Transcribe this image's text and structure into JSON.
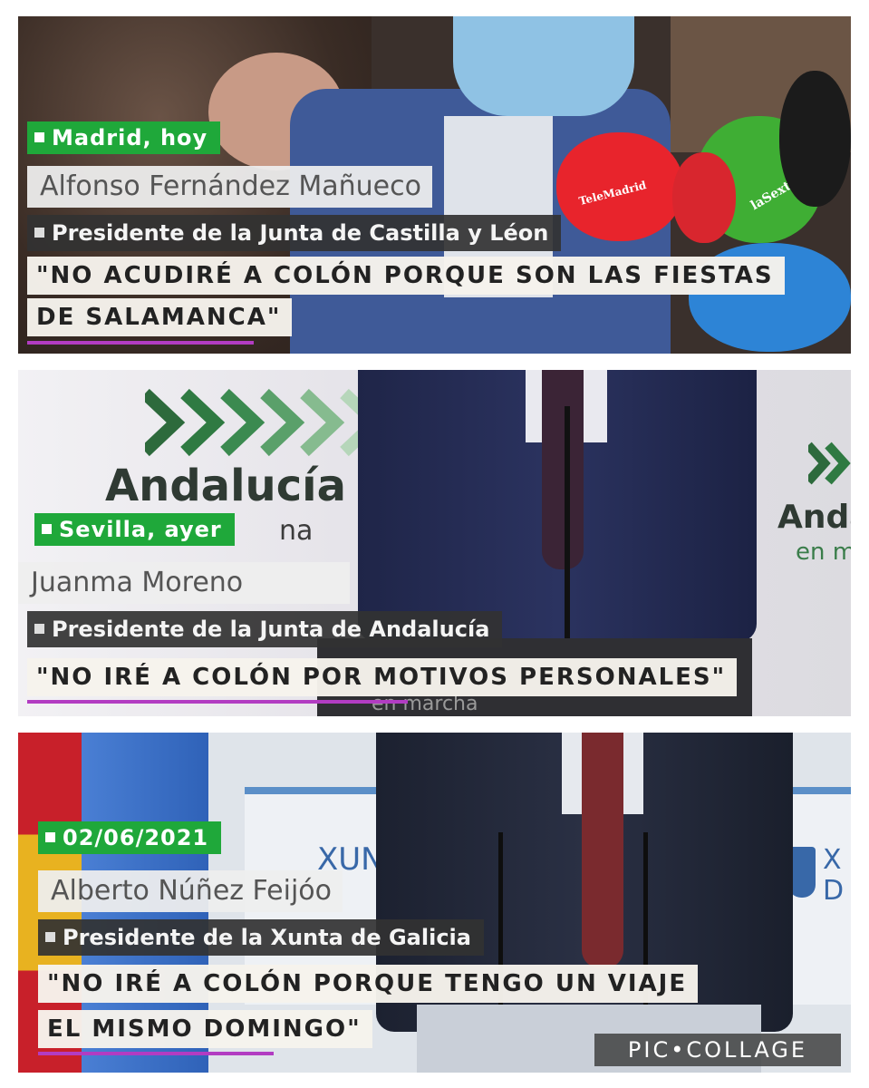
{
  "panels": [
    {
      "location": "Madrid, hoy",
      "name": "Alfonso Fernández Mañueco",
      "role": "Presidente de la Junta de Castilla y Léon",
      "quote_line1": "\"NO ACUDIRÉ A COLÓN PORQUE SON LAS FIESTAS",
      "quote_line2": "DE SALAMANCA\"",
      "mic_labels": [
        "TeleMadrid",
        "laSexta"
      ]
    },
    {
      "location": "Sevilla, ayer",
      "name": "Juanma Moreno",
      "role": "Presidente de la Junta de Andalucía",
      "quote_line1": "\"NO IRÉ A COLÓN POR MOTIVOS PERSONALES\"",
      "logo_text": "Andalucía",
      "logo_sub": "na",
      "logo_right": "Anda",
      "logo_right_sub": "en m",
      "behind_text": "en marcha"
    },
    {
      "location": "02/06/2021",
      "name": "Alberto Núñez Feijóo",
      "role": "Presidente de la Xunta de Galicia",
      "quote_line1": "\"NO IRÉ A COLÓN PORQUE TENGO UN VIAJE",
      "quote_line2": "EL MISMO DOMINGO\"",
      "bg_text": "XUN",
      "bg_text_right": "X\nD"
    }
  ],
  "watermark": "PIC•COLLAGE",
  "colors": {
    "location_green": "#1fa83a",
    "name_bg": "#eeeeee",
    "role_bg": "#323232",
    "quote_bg": "#f6f3ec",
    "accent_underline": "#b23cc2"
  }
}
